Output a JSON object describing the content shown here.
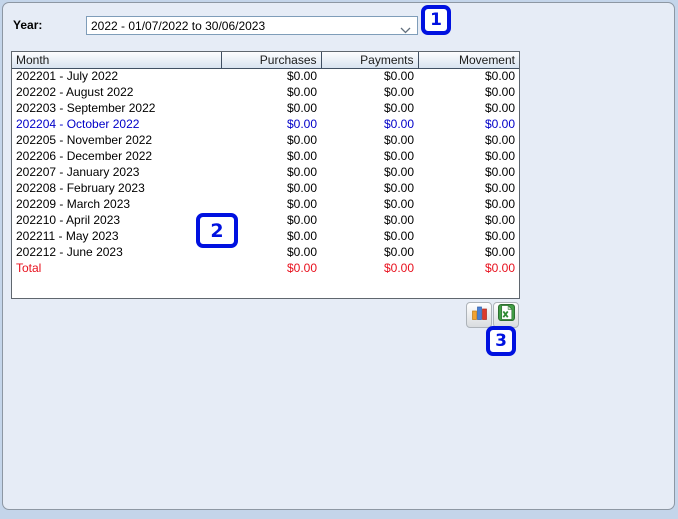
{
  "window": {
    "year_label": "Year:",
    "year_value": "2022 - 01/07/2022 to 30/06/2023"
  },
  "table": {
    "columns": [
      "Month",
      "Purchases",
      "Payments",
      "Movement"
    ],
    "rows": [
      {
        "month": "202201 - July 2022",
        "purchases": "$0.00",
        "payments": "$0.00",
        "movement": "$0.00"
      },
      {
        "month": "202202 - August 2022",
        "purchases": "$0.00",
        "payments": "$0.00",
        "movement": "$0.00"
      },
      {
        "month": "202203 - September 2022",
        "purchases": "$0.00",
        "payments": "$0.00",
        "movement": "$0.00"
      },
      {
        "month": "202204 - October 2022",
        "purchases": "$0.00",
        "payments": "$0.00",
        "movement": "$0.00",
        "highlight": true
      },
      {
        "month": "202205 - November 2022",
        "purchases": "$0.00",
        "payments": "$0.00",
        "movement": "$0.00"
      },
      {
        "month": "202206 - December 2022",
        "purchases": "$0.00",
        "payments": "$0.00",
        "movement": "$0.00"
      },
      {
        "month": "202207 - January 2023",
        "purchases": "$0.00",
        "payments": "$0.00",
        "movement": "$0.00"
      },
      {
        "month": "202208 - February 2023",
        "purchases": "$0.00",
        "payments": "$0.00",
        "movement": "$0.00"
      },
      {
        "month": "202209 - March 2023",
        "purchases": "$0.00",
        "payments": "$0.00",
        "movement": "$0.00"
      },
      {
        "month": "202210 - April 2023",
        "purchases": "$0.00",
        "payments": "$0.00",
        "movement": "$0.00"
      },
      {
        "month": "202211 - May 2023",
        "purchases": "$0.00",
        "payments": "$0.00",
        "movement": "$0.00"
      },
      {
        "month": "202212 - June 2023",
        "purchases": "$0.00",
        "payments": "$0.00",
        "movement": "$0.00"
      }
    ],
    "total_row": {
      "month": "Total",
      "purchases": "$0.00",
      "payments": "$0.00",
      "movement": "$0.00"
    }
  },
  "toolbar": {
    "icons": [
      "bar-chart-icon",
      "excel-export-icon"
    ]
  },
  "annotations": {
    "marks": [
      "1",
      "2",
      "3"
    ]
  },
  "colors": {
    "annotation_blue": "#0011e0",
    "highlight_row_blue": "#0000c8",
    "total_row_red": "#e8101d",
    "excel_green": "#43a047",
    "panel_background": "#e6ecf6",
    "outer_background": "#c4d5ea"
  }
}
